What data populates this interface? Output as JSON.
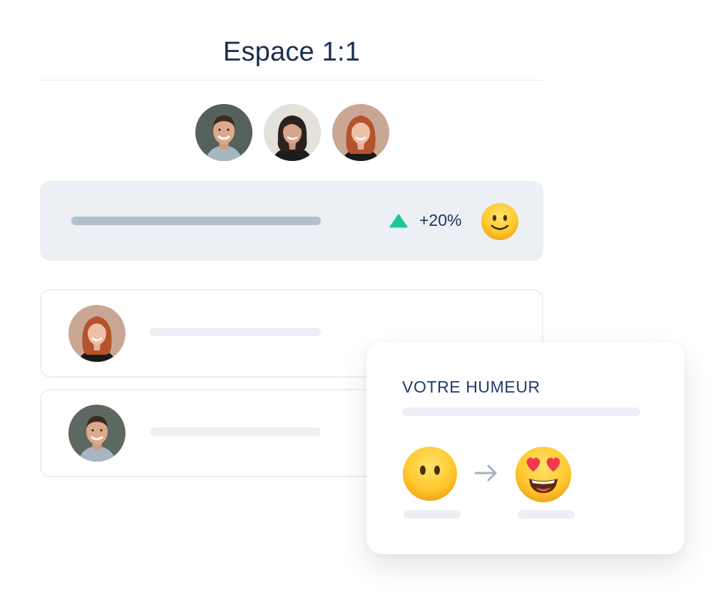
{
  "header": {
    "title": "Espace 1:1"
  },
  "participants": [
    {
      "icon": "man-avatar"
    },
    {
      "icon": "woman-dark-hair-avatar"
    },
    {
      "icon": "woman-red-hair-avatar"
    }
  ],
  "stats": {
    "trend_icon": "triangle-up-icon",
    "trend_value": "+20%",
    "trend_color": "#1fc49a",
    "mood_icon": "slightly-smiling-face-emoji"
  },
  "list": [
    {
      "avatar": "woman-red-hair-avatar"
    },
    {
      "avatar": "man-avatar"
    }
  ],
  "mood_card": {
    "title": "VOTRE HUMEUR",
    "from_icon": "face-without-mouth-emoji",
    "arrow_icon": "arrow-right-icon",
    "to_icon": "heart-eyes-emoji"
  },
  "colors": {
    "title": "#163150",
    "accent": "#1fc49a",
    "card_bg": "#ecf0f4",
    "bar": "#b1bfcd"
  }
}
